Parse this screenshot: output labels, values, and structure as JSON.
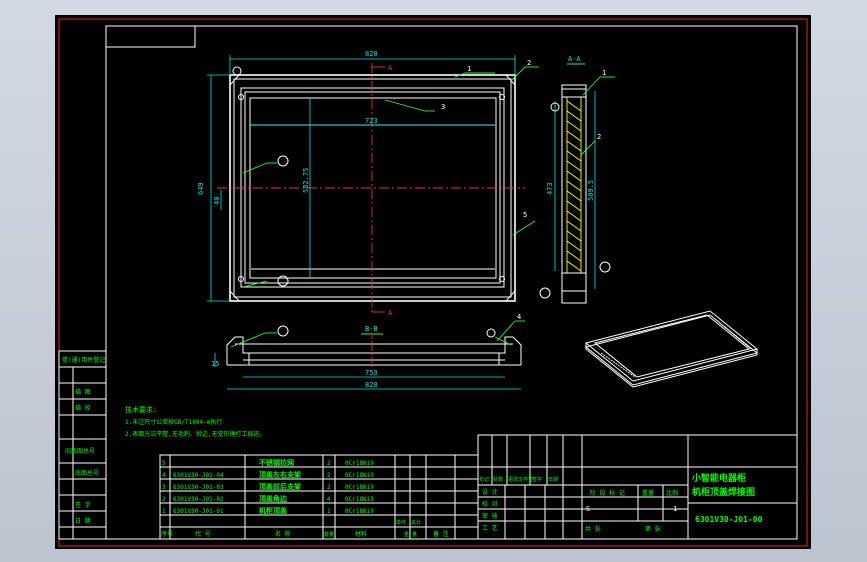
{
  "colors": {
    "background": "#c4cbd6",
    "canvas": "#000000",
    "border": "#ff2a2a",
    "dimension": "#00e6e6",
    "outline": "#ffffff",
    "annotation": "#00ff00",
    "hatch": "#ffff00"
  },
  "front_view": {
    "dim_top": "820",
    "dim_inner": "723",
    "dim_height": "649",
    "dim_inner_height": "582.75",
    "dim_side": "40",
    "section_mark": "A",
    "balloons": [
      "1",
      "2",
      "3",
      "4",
      "5"
    ]
  },
  "section_aa": {
    "title": "A-A",
    "dim_height": "473",
    "dim_outer": "509.5",
    "balloons": [
      "1",
      "2"
    ]
  },
  "section_bb": {
    "title": "B-B",
    "dim_height": "15",
    "dim_inner": "753",
    "dim_outer": "820",
    "balloon": "4"
  },
  "left_strip": {
    "labels": [
      "借(通)用件登记",
      "描 图",
      "描 校",
      "旧底图总号",
      "底图总号",
      "签 字",
      "日 期"
    ]
  },
  "tech_notes": {
    "title": "技术要求:",
    "lines": [
      "1.未注尺寸公差按GB/T1804-m执行",
      "2.表面光洁平整,无毛刺、锐边,无变形锤打工痕迹。"
    ]
  },
  "bom": {
    "rows": [
      {
        "no": "5",
        "code": "",
        "name": "不锈钢拉网",
        "qty": "2",
        "material": "0Cr18Ni9"
      },
      {
        "no": "4",
        "code": "6301V30-J01-04",
        "name": "顶盖左右支架",
        "qty": "2",
        "material": "0Cr18Ni9"
      },
      {
        "no": "3",
        "code": "6301V30-J01-03",
        "name": "顶盖前后支架",
        "qty": "2",
        "material": "0Cr18Ni9"
      },
      {
        "no": "2",
        "code": "6301V30-J01-02",
        "name": "顶盖角边",
        "qty": "4",
        "material": "0Cr18Ni9"
      },
      {
        "no": "1",
        "code": "6301V30-J01-01",
        "name": "机柜顶盖",
        "qty": "1",
        "material": "0Cr18Ni9"
      }
    ],
    "header": {
      "no": "序号",
      "code": "代 号",
      "name": "名 称",
      "qty": "数量",
      "material": "材料",
      "unit": "单件",
      "total": "总计",
      "weight": "重 量",
      "note": "备 注"
    }
  },
  "title_block": {
    "title_line1": "小智能电器柜",
    "title_line2": "机柜顶盖焊接图",
    "drawing_no": "6301V30-J01-00",
    "row_labels": [
      "标记",
      "处数",
      "更改文件号",
      "签字",
      "日期"
    ],
    "role_labels": [
      "设 计",
      "校 对",
      "审 核",
      "工 艺"
    ],
    "stage_labels": [
      "阶 段 标 记",
      "重量",
      "比例"
    ],
    "stage_value": "S",
    "scale_value": "1",
    "sheets": "共 张",
    "sheet_no": "第 张"
  }
}
